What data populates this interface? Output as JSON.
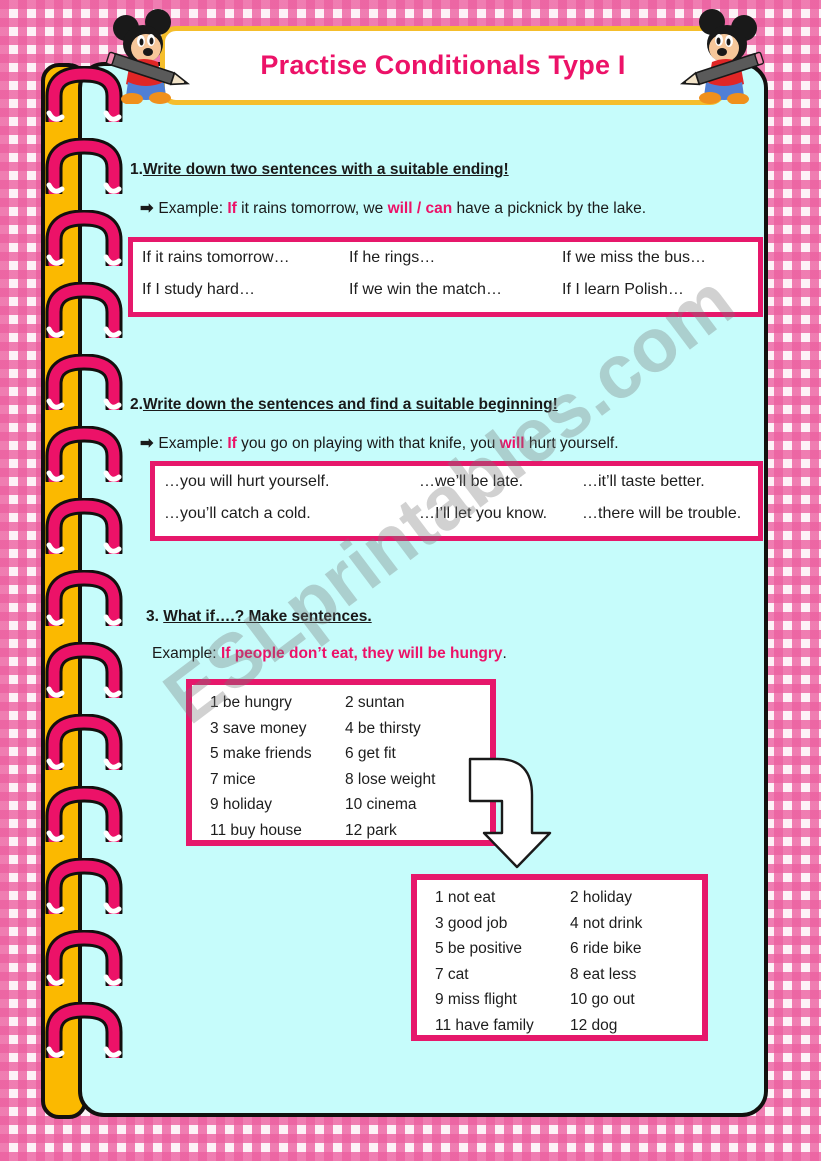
{
  "title": {
    "text": "Practise Conditionals Type I"
  },
  "watermark": {
    "text": "ESLprintables.com"
  },
  "decorations": {
    "mickey_left": "mickey-mouse-with-pencil",
    "mickey_right": "mickey-mouse-with-pencil",
    "binding": "spiral-binding-rings",
    "arrow": "curved-down-arrow"
  },
  "colors": {
    "accent_pink": "#ec1268",
    "box_border": "#e6186b",
    "title_border": "#f5be2c",
    "sheet_bg": "#c6fcfb",
    "binding": "#fbb900",
    "page_border": "#ec60a0"
  },
  "sections": [
    {
      "number": "1.",
      "heading": "Write down two sentences with a suitable ending!",
      "example_label": "Example:",
      "example_parts": [
        {
          "text": "If",
          "highlight": true
        },
        {
          "text": " it rains tomorrow, we ",
          "highlight": false
        },
        {
          "text": "will / can",
          "highlight": true
        },
        {
          "text": " have a picknick by the lake.",
          "highlight": false
        }
      ],
      "box_rows": [
        [
          "If it rains tomorrow…",
          "If he rings…",
          "If we miss the bus…"
        ],
        [
          "If I study hard…",
          "If we win the match…",
          "If I learn Polish…"
        ]
      ]
    },
    {
      "number": "2.",
      "heading": "Write down the sentences and find a suitable beginning!",
      "example_label": "Example:",
      "example_parts": [
        {
          "text": "If",
          "highlight": true
        },
        {
          "text": " you go on playing with that knife, you ",
          "highlight": false
        },
        {
          "text": "will",
          "highlight": true
        },
        {
          "text": " hurt yourself.",
          "highlight": false
        }
      ],
      "box_rows": [
        [
          "…you will hurt yourself.",
          "…we’ll be late.",
          "…it’ll taste better."
        ],
        [
          "…you’ll catch a cold.",
          "…I’ll let you know.",
          "…there will be trouble."
        ]
      ]
    },
    {
      "number": "3. ",
      "heading": "What if….? Make sentences.",
      "example_label": "Example:",
      "example_parts": [
        {
          "text": "If people don’t eat, they will be hungry",
          "highlight": true
        },
        {
          "text": ".",
          "highlight": false
        }
      ]
    }
  ],
  "word_lists": [
    {
      "name": "first-word-list",
      "rows": [
        [
          "1 be hungry",
          "2 suntan"
        ],
        [
          "3 save money",
          "4 be thirsty"
        ],
        [
          "5 make friends",
          "6 get fit"
        ],
        [
          "7 mice",
          "8 lose weight"
        ],
        [
          "9 holiday",
          "10 cinema"
        ],
        [
          "11 buy house",
          "12 park"
        ]
      ]
    },
    {
      "name": "second-word-list",
      "rows": [
        [
          "1 not eat",
          "2 holiday"
        ],
        [
          "3 good job",
          "4 not drink"
        ],
        [
          "5 be positive",
          "6 ride bike"
        ],
        [
          "7 cat",
          "8 eat less"
        ],
        [
          "9 miss flight",
          "10 go out"
        ],
        [
          "11 have family",
          "12 dog"
        ]
      ]
    }
  ]
}
